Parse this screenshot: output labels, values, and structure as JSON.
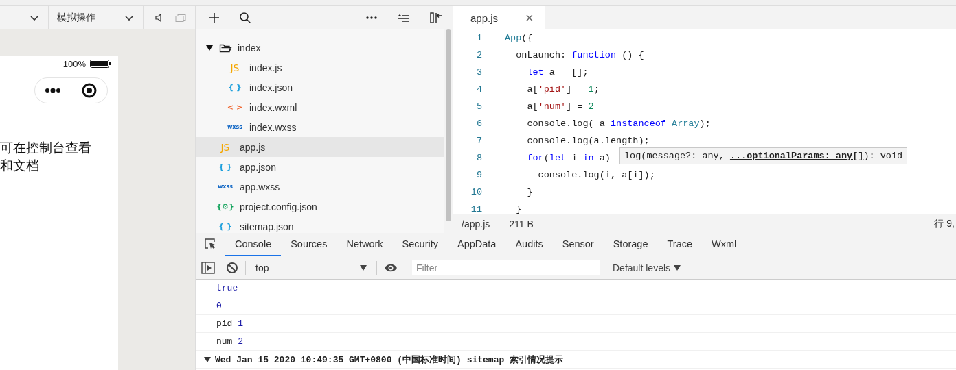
{
  "simulator": {
    "toolbar": {
      "dropdowns": [
        {
          "kind": "device"
        },
        {
          "kind": "action",
          "label": "模拟操作"
        }
      ]
    },
    "phone": {
      "battery": "100%",
      "lines": [
        "可在控制台查看",
        "和文档"
      ]
    }
  },
  "explorer": {
    "tree": [
      {
        "name": "index",
        "kind": "folder",
        "expanded": true,
        "selected": false,
        "children": [
          {
            "name": "index.js",
            "kind": "js",
            "badge": "JS",
            "selected": false
          },
          {
            "name": "index.json",
            "kind": "json",
            "badge": "{ }",
            "selected": false
          },
          {
            "name": "index.wxml",
            "kind": "wxml",
            "badge": "< >",
            "selected": false
          },
          {
            "name": "index.wxss",
            "kind": "wxss",
            "badge": "wxss",
            "selected": false
          }
        ]
      },
      {
        "name": "app.js",
        "kind": "js",
        "badge": "JS",
        "selected": true
      },
      {
        "name": "app.json",
        "kind": "json",
        "badge": "{ }",
        "selected": false
      },
      {
        "name": "app.wxss",
        "kind": "wxss",
        "badge": "wxss",
        "selected": false
      },
      {
        "name": "project.config.json",
        "kind": "config",
        "badge": "{⚙}",
        "selected": false
      },
      {
        "name": "sitemap.json",
        "kind": "json",
        "badge": "{ }",
        "selected": false
      }
    ]
  },
  "editor": {
    "tabs": [
      {
        "label": "app.js",
        "close": "×",
        "selected": true
      }
    ],
    "lines": [
      {
        "number": "1",
        "tokens": [
          {
            "text": "App",
            "kind": "type"
          },
          {
            "text": "({",
            "kind": "plain"
          }
        ]
      },
      {
        "number": "2",
        "tokens": [
          {
            "text": "  onLaunch: ",
            "kind": "plain"
          },
          {
            "text": "function",
            "kind": "keyword"
          },
          {
            "text": " () {",
            "kind": "plain"
          }
        ]
      },
      {
        "number": "3",
        "tokens": [
          {
            "text": "    let",
            "kind": "keyword"
          },
          {
            "text": " a = [];",
            "kind": "plain"
          }
        ]
      },
      {
        "number": "4",
        "tokens": [
          {
            "text": "    a[",
            "kind": "plain"
          },
          {
            "text": "'pid'",
            "kind": "string"
          },
          {
            "text": "] = ",
            "kind": "plain"
          },
          {
            "text": "1",
            "kind": "number"
          },
          {
            "text": ";",
            "kind": "plain"
          }
        ]
      },
      {
        "number": "5",
        "tokens": [
          {
            "text": "    a[",
            "kind": "plain"
          },
          {
            "text": "'num'",
            "kind": "string"
          },
          {
            "text": "] = ",
            "kind": "plain"
          },
          {
            "text": "2",
            "kind": "number"
          }
        ]
      },
      {
        "number": "6",
        "tokens": [
          {
            "text": "    console.log( a ",
            "kind": "plain"
          },
          {
            "text": "instanceof ",
            "kind": "keyword"
          },
          {
            "text": "Array",
            "kind": "type"
          },
          {
            "text": ");",
            "kind": "plain"
          }
        ]
      },
      {
        "number": "7",
        "tokens": [
          {
            "text": "    console.log(a.length);",
            "kind": "plain"
          }
        ]
      },
      {
        "number": "8",
        "tokens": [
          {
            "text": "    for",
            "kind": "keyword"
          },
          {
            "text": "(",
            "kind": "plain"
          },
          {
            "text": "let",
            "kind": "keyword"
          },
          {
            "text": " i ",
            "kind": "plain"
          },
          {
            "text": "in",
            "kind": "keyword"
          },
          {
            "text": " a)",
            "kind": "plain"
          }
        ]
      },
      {
        "number": "9",
        "tokens": [
          {
            "text": "      console.log(i, a[i]);",
            "kind": "plain"
          }
        ]
      },
      {
        "number": "10",
        "tokens": [
          {
            "text": "    }",
            "kind": "plain"
          }
        ]
      },
      {
        "number": "11",
        "tokens": [
          {
            "text": "  }",
            "kind": "plain"
          }
        ]
      }
    ],
    "tooltip": "log(message?: any, **...optionalParams: any[]**): void",
    "status_bar": {
      "path": "/app.js",
      "size": "211 B",
      "position": "行 9,"
    }
  },
  "console": {
    "tabs": [
      {
        "label": "Console",
        "selected": true
      },
      {
        "label": "Sources",
        "selected": false
      },
      {
        "label": "Network",
        "selected": false
      },
      {
        "label": "Security",
        "selected": false
      },
      {
        "label": "AppData",
        "selected": false
      },
      {
        "label": "Audits",
        "selected": false
      },
      {
        "label": "Sensor",
        "selected": false
      },
      {
        "label": "Storage",
        "selected": false
      },
      {
        "label": "Trace",
        "selected": false
      },
      {
        "label": "Wxml",
        "selected": false
      }
    ],
    "context": "top",
    "filter_placeholder": "Filter",
    "levels": "Default levels",
    "messages": [
      {
        "kind": "value",
        "tokens": [
          {
            "text": "true",
            "kind": "keyword"
          }
        ]
      },
      {
        "kind": "value",
        "tokens": [
          {
            "text": "0",
            "kind": "number"
          }
        ]
      },
      {
        "kind": "value",
        "tokens": [
          {
            "text": "pid ",
            "kind": "plain"
          },
          {
            "text": "1",
            "kind": "number"
          }
        ]
      },
      {
        "kind": "value",
        "tokens": [
          {
            "text": "num ",
            "kind": "plain"
          },
          {
            "text": "2",
            "kind": "number"
          }
        ]
      },
      {
        "kind": "group",
        "expanded": true,
        "tokens": [
          {
            "text": "Wed Jan 15 2020 10:49:35 GMT+0800 (中国标准时间) sitemap 索引情况提示",
            "kind": "plain"
          }
        ]
      }
    ]
  }
}
